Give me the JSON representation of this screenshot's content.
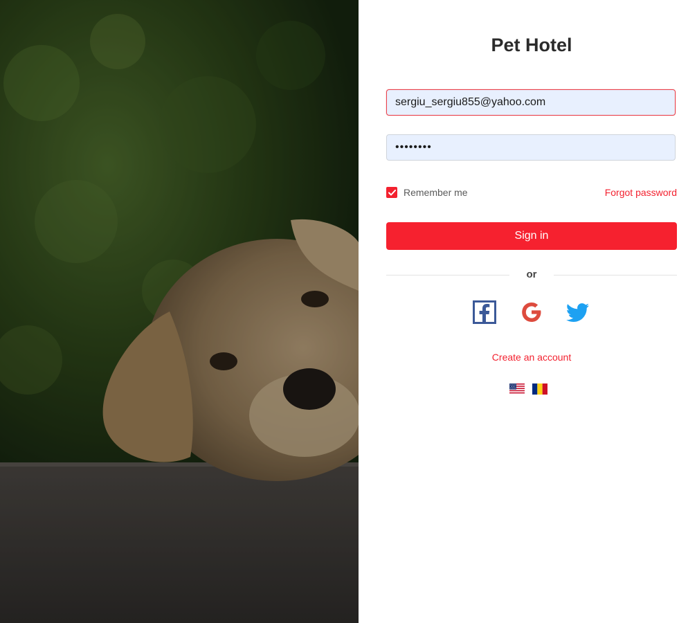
{
  "app": {
    "title": "Pet Hotel"
  },
  "login": {
    "email_value": "sergiu_sergiu855@yahoo.com",
    "password_value": "••••••••",
    "remember_label": "Remember me",
    "remember_checked": true,
    "forgot_label": "Forgot password",
    "signin_label": "Sign in",
    "divider_label": "or",
    "create_account_label": "Create an account"
  },
  "social": [
    "facebook-icon",
    "google-icon",
    "twitter-icon"
  ],
  "languages": [
    "us-flag-icon",
    "romania-flag-icon"
  ],
  "colors": {
    "accent": "#f6212f",
    "input_bg": "#e8f0fe",
    "facebook": "#3b5998",
    "twitter": "#1da1f2"
  }
}
